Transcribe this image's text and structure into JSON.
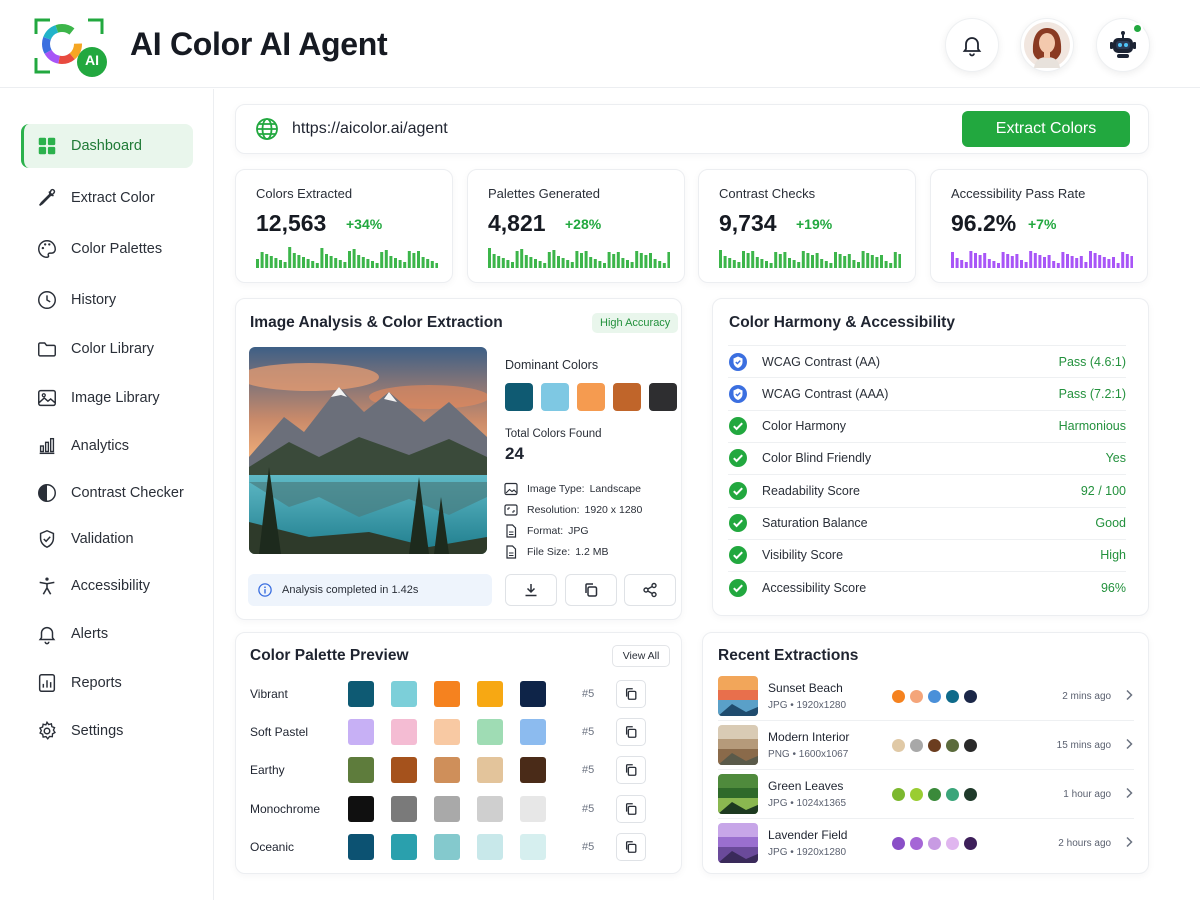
{
  "app": {
    "title": "AI Color AI Agent",
    "logo_badge": "AI",
    "brand_color": "#22a83f"
  },
  "header": {
    "icons": [
      "bell-icon",
      "user-avatar",
      "robot-icon"
    ],
    "robot_status_color": "#22a83f"
  },
  "sidebar": {
    "items": [
      {
        "label": "Dashboard",
        "icon": "dashboard-icon",
        "active": true
      },
      {
        "label": "Extract Color",
        "icon": "eyedropper-icon"
      },
      {
        "label": "Color Palettes",
        "icon": "palette-icon"
      },
      {
        "label": "History",
        "icon": "clock-icon"
      },
      {
        "label": "Color Library",
        "icon": "folder-icon"
      },
      {
        "label": "Image Library",
        "icon": "image-icon"
      },
      {
        "label": "Analytics",
        "icon": "bar-chart-icon"
      },
      {
        "label": "Contrast Checker",
        "icon": "contrast-icon"
      },
      {
        "label": "Validation",
        "icon": "shield-check-icon"
      },
      {
        "label": "Accessibility",
        "icon": "accessibility-icon"
      },
      {
        "label": "Alerts",
        "icon": "bell-icon"
      },
      {
        "label": "Reports",
        "icon": "report-icon"
      },
      {
        "label": "Settings",
        "icon": "gear-icon"
      }
    ]
  },
  "url_bar": {
    "value": "https://aicolor.ai/agent",
    "button_label": "Extract Colors"
  },
  "stats": [
    {
      "label": "Colors Extracted",
      "value": "12,563",
      "delta": "+34%",
      "color": "#3cb54a"
    },
    {
      "label": "Palettes Generated",
      "value": "4,821",
      "delta": "+28%",
      "color": "#3cb54a"
    },
    {
      "label": "Contrast Checks",
      "value": "9,734",
      "delta": "+19%",
      "color": "#3cb54a"
    },
    {
      "label": "Accessibility Pass Rate",
      "value": "96.2%",
      "delta": "+7%",
      "color": "#a855f7"
    }
  ],
  "analysis": {
    "title": "Image Analysis & Color Extraction",
    "badge": "High Accuracy",
    "dominant_label": "Dominant Colors",
    "dominant_colors": [
      "#0f5a72",
      "#7ec8e3",
      "#f59b50",
      "#c0652a",
      "#2e2e30"
    ],
    "total_label": "Total Colors Found",
    "total_value": "24",
    "meta": [
      {
        "key": "Image Type:",
        "value": "Landscape",
        "icon": "image-icon"
      },
      {
        "key": "Resolution:",
        "value": "1920 x 1280",
        "icon": "resolution-icon"
      },
      {
        "key": "Format:",
        "value": "JPG",
        "icon": "file-icon"
      },
      {
        "key": "File Size:",
        "value": "1.2 MB",
        "icon": "file-icon"
      }
    ],
    "notice": "Analysis completed in 1.42s",
    "actions": [
      "download-icon",
      "copy-icon",
      "share-icon"
    ]
  },
  "harmony": {
    "title": "Color Harmony & Accessibility",
    "rows": [
      {
        "label": "WCAG Contrast (AA)",
        "value": "Pass (4.6:1)",
        "icon": "shield-check-icon",
        "color": "#3b6fe0"
      },
      {
        "label": "WCAG Contrast (AAA)",
        "value": "Pass (7.2:1)",
        "icon": "shield-check-icon",
        "color": "#3b6fe0"
      },
      {
        "label": "Color Harmony",
        "value": "Harmonious",
        "icon": "check-circle-icon",
        "color": "#22a83f"
      },
      {
        "label": "Color Blind Friendly",
        "value": "Yes",
        "icon": "check-circle-icon",
        "color": "#22a83f"
      },
      {
        "label": "Readability Score",
        "value": "92 / 100",
        "icon": "check-circle-icon",
        "color": "#22a83f"
      },
      {
        "label": "Saturation Balance",
        "value": "Good",
        "icon": "check-circle-icon",
        "color": "#22a83f"
      },
      {
        "label": "Visibility Score",
        "value": "High",
        "icon": "check-circle-icon",
        "color": "#22a83f"
      },
      {
        "label": "Accessibility Score",
        "value": "96%",
        "icon": "check-circle-icon",
        "color": "#22a83f"
      }
    ]
  },
  "palettes": {
    "title": "Color Palette Preview",
    "view_all": "View All",
    "rows": [
      {
        "name": "Vibrant",
        "count": "#5",
        "colors": [
          "#0e5a73",
          "#7ccfd9",
          "#f5821f",
          "#f7a813",
          "#0e2448"
        ]
      },
      {
        "name": "Soft Pastel",
        "count": "#5",
        "colors": [
          "#c7b0f5",
          "#f4bcd3",
          "#f8c9a3",
          "#9fdcb4",
          "#8cbbef"
        ]
      },
      {
        "name": "Earthy",
        "count": "#5",
        "colors": [
          "#5e7c3c",
          "#a5521c",
          "#cf8f5a",
          "#e3c49b",
          "#4a2b18"
        ]
      },
      {
        "name": "Monochrome",
        "count": "#5",
        "colors": [
          "#101010",
          "#7a7a7a",
          "#a9a9a9",
          "#cfcfcf",
          "#e7e7e7"
        ]
      },
      {
        "name": "Oceanic",
        "count": "#5",
        "colors": [
          "#0c5272",
          "#2aa0ad",
          "#84c9cd",
          "#c8e8ea",
          "#d6efef"
        ]
      }
    ]
  },
  "recent": {
    "title": "Recent Extractions",
    "items": [
      {
        "name": "Sunset Beach",
        "meta": "JPG • 1920x1280",
        "time": "2 mins ago",
        "colors": [
          "#f5821f",
          "#f4a57a",
          "#4a90d9",
          "#0e6a8a",
          "#1b2748"
        ],
        "thumb": [
          "#f2a65a",
          "#e86f4c",
          "#5aa0c8",
          "#1f4c6e"
        ]
      },
      {
        "name": "Modern Interior",
        "meta": "PNG • 1600x1067",
        "time": "15 mins ago",
        "colors": [
          "#e0c9a6",
          "#a8a8a8",
          "#6b3d1f",
          "#5b6b3c",
          "#2a2a2a"
        ],
        "thumb": [
          "#d9cbb5",
          "#b59a7a",
          "#8a6a4a",
          "#5a5a4a"
        ]
      },
      {
        "name": "Green Leaves",
        "meta": "JPG • 1024x1365",
        "time": "1 hour ago",
        "colors": [
          "#7cb82f",
          "#9acd32",
          "#3a8a3a",
          "#3aa57a",
          "#1f3a2a"
        ],
        "thumb": [
          "#4f8a3c",
          "#2f6a2a",
          "#8ab850",
          "#1d3a20"
        ]
      },
      {
        "name": "Lavender Field",
        "meta": "JPG • 1920x1280",
        "time": "2 hours ago",
        "colors": [
          "#8a4fc7",
          "#a566d6",
          "#c89be3",
          "#e0b6ef",
          "#3d1f5a"
        ],
        "thumb": [
          "#c7a6e8",
          "#9a6fcf",
          "#6a4a9a",
          "#3a2a5a"
        ]
      }
    ]
  }
}
